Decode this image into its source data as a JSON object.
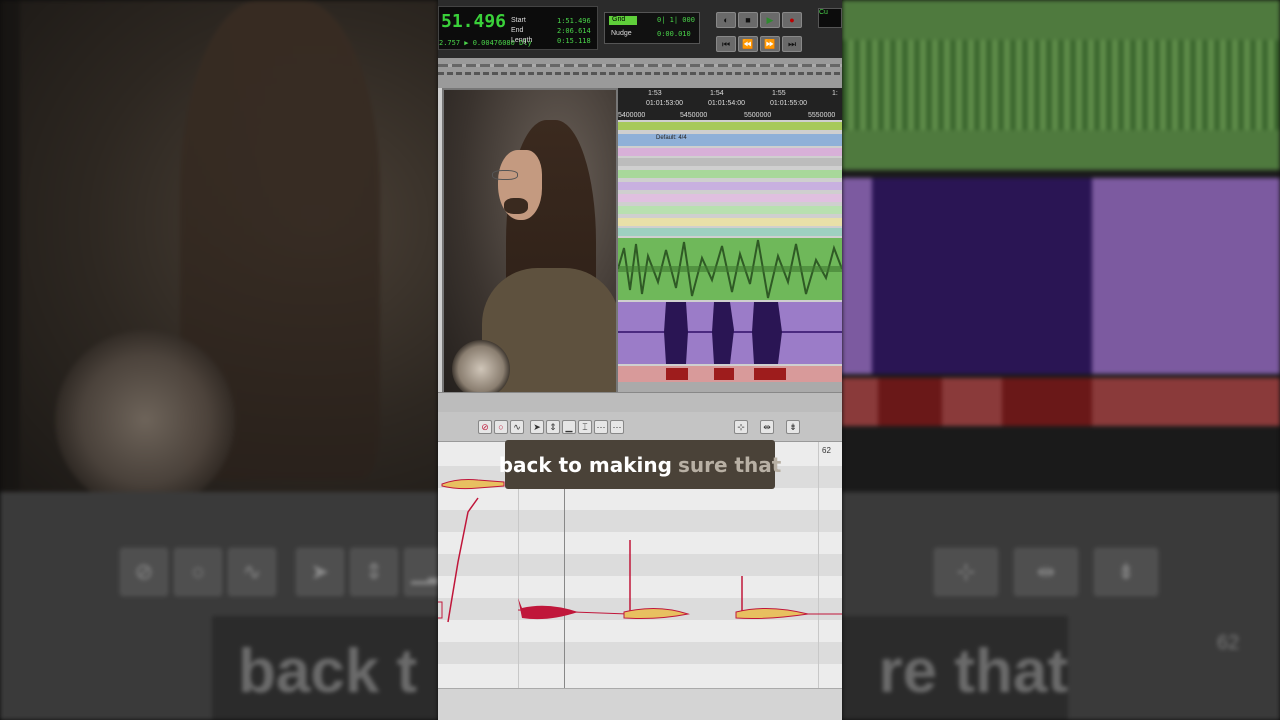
{
  "transport": {
    "main_counter": "51.496",
    "sub_counter": "2.757 ▶ 0.00476080 Dly",
    "selection": {
      "labels": [
        "Start",
        "End",
        "Length"
      ],
      "values": [
        "1:51.496",
        "2:06.614",
        "0:15.118"
      ]
    },
    "grid": {
      "label": "Grid",
      "value": "0| 1| 000"
    },
    "nudge": {
      "label": "Nudge",
      "value": "0:00.010"
    },
    "corner": "Cu"
  },
  "timeline": {
    "bars": [
      "1:53",
      "1:54",
      "1:55",
      "1:"
    ],
    "timecodes": [
      "01:01:53:00",
      "01:01:54:00",
      "01:01:55:00"
    ],
    "samples": [
      "5400000",
      "5450000",
      "5500000",
      "5550000"
    ],
    "meter": "Default: 4/4"
  },
  "editor": {
    "ruler_number": "62",
    "right_panel_number": "62"
  },
  "caption": {
    "highlight": "back to making",
    "rest": "sure that"
  },
  "background_caption": {
    "left": "back t",
    "right": "re that"
  },
  "colors": {
    "green_track": "#6fb85a",
    "purple_track": "#9b7cc8",
    "red_clip": "#9e1c1c",
    "pitch_blob": "#c0163a",
    "counter_green": "#3ad13a"
  }
}
